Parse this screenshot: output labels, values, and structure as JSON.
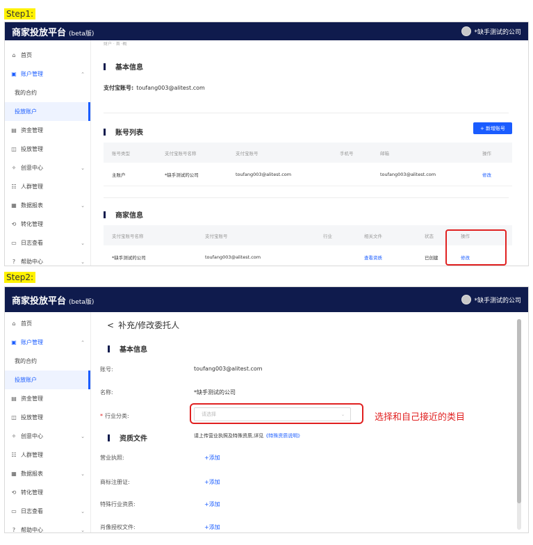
{
  "step1_label": "Step1:",
  "step2_label": "Step2:",
  "app": {
    "title": "商家投放平台",
    "beta": "(beta版)",
    "user_name": "*缺手测试的公司"
  },
  "sidebar1": {
    "items": [
      {
        "icon": "home-icon",
        "glyph": "⌂",
        "label": "首页"
      },
      {
        "icon": "account-icon",
        "glyph": "▣",
        "label": "账户管理",
        "chev": "⌃"
      },
      {
        "label": "我的合约"
      },
      {
        "label": "投放账户"
      },
      {
        "icon": "wallet-icon",
        "glyph": "▤",
        "label": "资金管理"
      },
      {
        "icon": "ad-icon",
        "glyph": "◫",
        "label": "投放管理"
      },
      {
        "icon": "creative-icon",
        "glyph": "✧",
        "label": "创意中心",
        "chev": "⌄"
      },
      {
        "icon": "people-icon",
        "glyph": "☷",
        "label": "人群管理"
      },
      {
        "icon": "report-icon",
        "glyph": "▦",
        "label": "数据报表",
        "chev": "⌄"
      },
      {
        "icon": "convert-icon",
        "glyph": "⟲",
        "label": "转化管理"
      },
      {
        "icon": "log-icon",
        "glyph": "▭",
        "label": "日志查看",
        "chev": "⌄"
      },
      {
        "icon": "help-icon",
        "glyph": "?",
        "label": "帮助中心",
        "chev": "⌄"
      }
    ]
  },
  "step1": {
    "breadcrumb": "财户 · 首 ·概",
    "basic_title": "基本信息",
    "alipay_label": "支付宝账号:",
    "alipay_value": "toufang003@alitest.com",
    "account_list_title": "账号列表",
    "add_button": "+ 新增账号",
    "account_table": {
      "headers": [
        "账号类型",
        "支付宝账号名称",
        "支付宝账号",
        "手机号",
        "邮箱",
        "操作"
      ],
      "row": [
        "主账户",
        "*缺手测试的公司",
        "toufang003@alitest.com",
        "",
        "toufang003@alitest.com",
        "修改"
      ]
    },
    "merchant_title": "商家信息",
    "merchant_table": {
      "headers": [
        "支付宝账号名称",
        "支付宝账号",
        "行业",
        "相关文件",
        "状态",
        "操作"
      ],
      "row": [
        "*缺手测试的公司",
        "toufang003@alitest.com",
        "",
        "查看资质",
        "已创建",
        "修改"
      ]
    }
  },
  "step2": {
    "back_arrow": "<",
    "page_title": "补充/修改委托人",
    "basic_title": "基本信息",
    "account_label": "账号:",
    "account_value": "toufang003@alitest.com",
    "name_label": "名称:",
    "name_value": "*缺手测试的公司",
    "industry_req": "*",
    "industry_label": "行业分类:",
    "industry_placeholder": "请选择",
    "annotation": "选择和自己接近的类目",
    "qual_title": "资质文件",
    "qual_hint": "请上传营业执照及特殊资质,详见",
    "qual_link": "《特殊资质说明》",
    "docs": [
      {
        "label": "营业执照:",
        "action": "+添加"
      },
      {
        "label": "商标注册证:",
        "action": "+添加"
      },
      {
        "label": "特殊行业资质:",
        "action": "+添加"
      },
      {
        "label": "肖像授权文件:",
        "action": "+添加"
      }
    ]
  },
  "colors": {
    "topbar": "#0f1b4d",
    "accent": "#1a5cff",
    "highlight": "#e02020",
    "step_label_bg": "#fff200"
  }
}
